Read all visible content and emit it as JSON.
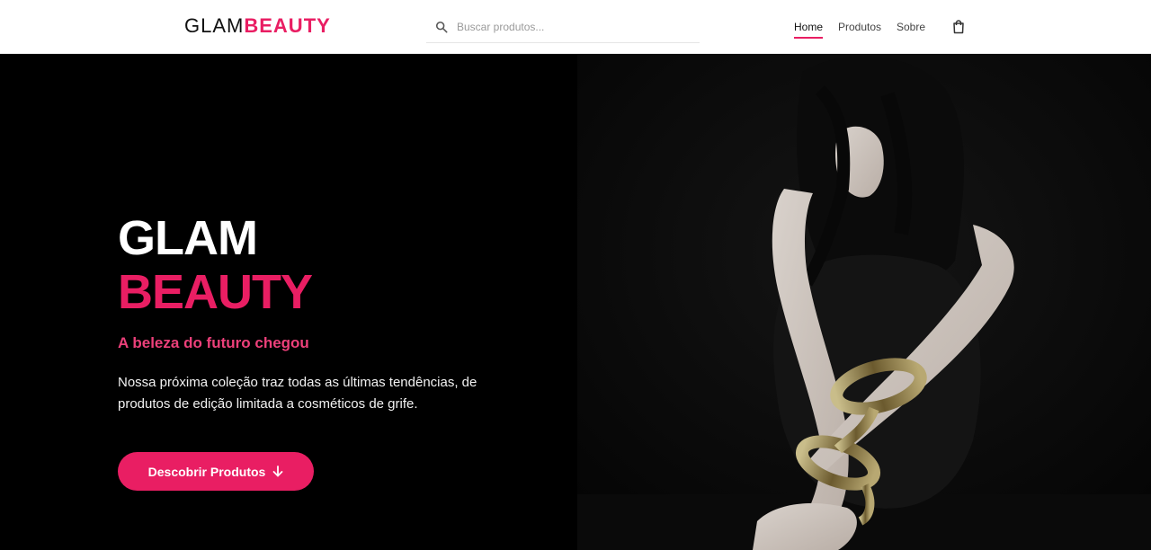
{
  "header": {
    "logo_part1": "GLAM",
    "logo_part2": "BEAUTY",
    "search_placeholder": "Buscar produtos...",
    "search_icon": "search-icon",
    "nav": [
      "Home",
      "Produtos",
      "Sobre"
    ],
    "active_nav": "Home",
    "cart_icon": "shopping-bag-icon"
  },
  "hero": {
    "title_line1": "GLAM",
    "title_line2": "BEAUTY",
    "subtitle": "A beleza do futuro chegou",
    "description": "Nossa próxima coleção traz todas as últimas tendências, de produtos de edição limitada a cosméticos de grife.",
    "cta_label": "Descobrir Produtos",
    "cta_icon": "arrow-down-icon"
  },
  "colors": {
    "accent": "#e91e63",
    "subtitle": "#ec407a",
    "background": "#000000",
    "header_bg": "#ffffff"
  }
}
